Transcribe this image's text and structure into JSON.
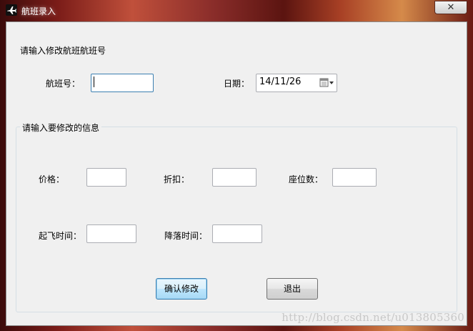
{
  "window": {
    "title": "航班录入",
    "close_label": "✕"
  },
  "search_section": {
    "prompt": "请输入修改航班航班号",
    "flight_no_label": "航班号：",
    "flight_no_value": "",
    "date_label": "日期：",
    "date_value": "14/11/26"
  },
  "edit_group": {
    "legend": "请输入要修改的信息",
    "price_label": "价格：",
    "discount_label": "折扣：",
    "seats_label": "座位数：",
    "departure_label": "起飞时间：",
    "landing_label": "降落时间："
  },
  "buttons": {
    "confirm": "确认修改",
    "exit": "退出"
  },
  "watermark": "http://blog.csdn.net/u013805360",
  "colors": {
    "focus_border": "#3c7fb1",
    "client_bg": "#f0f0f0"
  }
}
